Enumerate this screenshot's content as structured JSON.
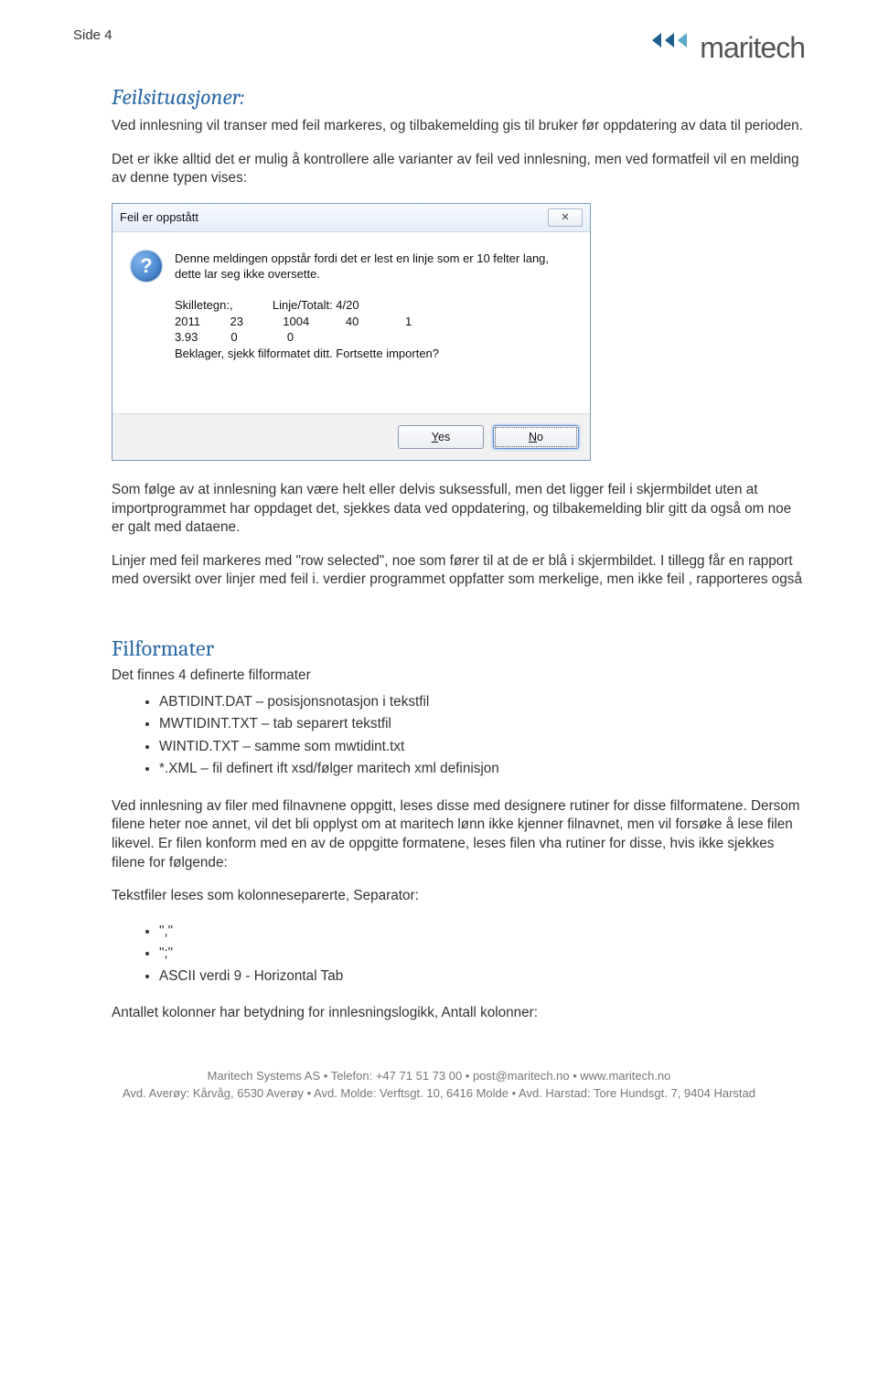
{
  "page_label": "Side 4",
  "logo_text": "maritech",
  "section1": {
    "title": "Feilsituasjoner:",
    "p1": "Ved innlesning vil transer med feil markeres, og tilbakemelding gis til bruker før oppdatering av data til perioden.",
    "p2": "Det er ikke alltid det er mulig å kontrollere alle varianter av feil ved innlesning, men ved formatfeil vil en melding av denne typen vises:"
  },
  "dialog": {
    "title": "Feil er oppstått",
    "close_glyph": "✕",
    "icon_glyph": "?",
    "line1": "Denne meldingen oppstår fordi det er lest en linje som er 10 felter lang,",
    "line2": "dette lar seg ikke oversette.",
    "row1": "Skilletegn:,            Linje/Totalt: 4/20",
    "row2": "2011         23            1004           40              1",
    "row3": "3.93          0               0",
    "line_last": "Beklager, sjekk filformatet ditt. Fortsette importen?",
    "yes": "Yes",
    "no": "No"
  },
  "after_dialog": {
    "p1": "Som følge av at innlesning kan være helt eller delvis suksessfull, men det ligger feil i skjermbildet uten at importprogrammet har oppdaget det, sjekkes data ved oppdatering, og tilbakemelding blir gitt da også om noe er galt med dataene.",
    "p2": "Linjer med feil markeres med \"row selected\", noe som fører til at de er blå i skjermbildet. I tillegg får en rapport med oversikt over linjer med feil i. verdier programmet oppfatter som merkelige, men ikke feil , rapporteres også"
  },
  "section2": {
    "title": "Filformater",
    "intro": "Det finnes 4 definerte filformater",
    "items": [
      "ABTIDINT.DAT – posisjonsnotasjon i tekstfil",
      "MWTIDINT.TXT – tab separert tekstfil",
      "WINTID.TXT – samme som mwtidint.txt",
      "*.XML – fil definert ift xsd/følger maritech xml definisjon"
    ],
    "p_after": "Ved innlesning av filer med filnavnene oppgitt, leses disse med designere rutiner for disse filformatene. Dersom filene heter noe annet, vil det bli opplyst om at maritech lønn ikke kjenner filnavnet, men vil forsøke å lese filen likevel. Er filen konform med en av de oppgitte formatene, leses filen vha rutiner for disse, hvis ikke sjekkes filene for følgende:",
    "separator_intro": "Tekstfiler leses som kolonneseparerte, Separator:",
    "separators": [
      "\",\"",
      "\";\"",
      "ASCII verdi 9 -  Horizontal Tab"
    ],
    "p_last": "Antallet kolonner har betydning for innlesningslogikk, Antall kolonner:"
  },
  "footer": {
    "line1": "Maritech Systems AS  •  Telefon: +47 71 51 73 00  •  post@maritech.no  •  www.maritech.no",
    "line2": "Avd. Averøy: Kårvåg, 6530 Averøy  •  Avd. Molde: Verftsgt. 10, 6416 Molde  •  Avd. Harstad: Tore Hundsgt. 7, 9404 Harstad"
  }
}
